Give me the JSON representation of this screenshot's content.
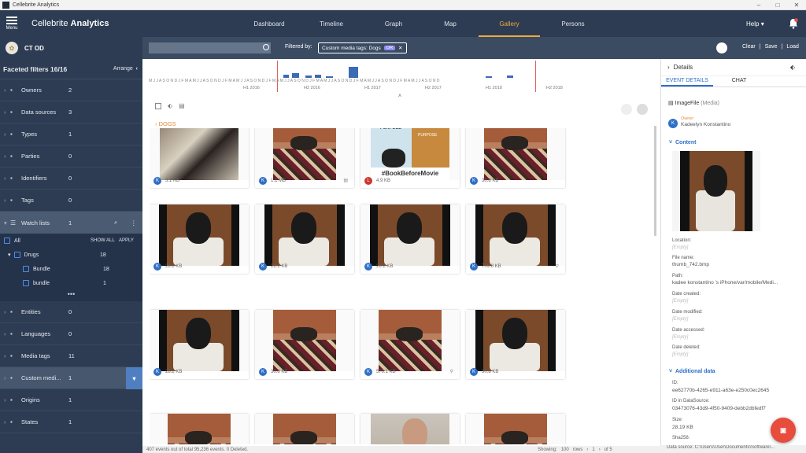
{
  "window": {
    "title": "Cellebrite Analytics"
  },
  "nav": {
    "menu_label": "Menu",
    "brand_a": "Cellebrite",
    "brand_b": "Analytics",
    "tabs": [
      {
        "label": "Dashboard"
      },
      {
        "label": "Timeline"
      },
      {
        "label": "Graph"
      },
      {
        "label": "Map"
      },
      {
        "label": "Gallery",
        "active": true
      },
      {
        "label": "Persons"
      }
    ],
    "help": "Help"
  },
  "case": {
    "name": "CT OD"
  },
  "search": {
    "placeholder": "Search..."
  },
  "filter": {
    "label": "Filtered by:",
    "chip": "Custom media tags: Dogs",
    "chip_badge": "OR"
  },
  "actions": {
    "clear": "Clear",
    "save": "Save",
    "load": "Load"
  },
  "sidebar": {
    "title": "Faceted filters 16/16",
    "arrange": "Arrange",
    "filters": [
      {
        "name": "Owners",
        "count": "2",
        "icon": "person-icon"
      },
      {
        "name": "Data sources",
        "count": "3",
        "icon": "phone-icon"
      },
      {
        "name": "Types",
        "count": "1",
        "icon": "grid-icon"
      },
      {
        "name": "Parties",
        "count": "0",
        "icon": "contact-icon"
      },
      {
        "name": "Identifiers",
        "count": "0",
        "icon": "id-card-icon"
      },
      {
        "name": "Tags",
        "count": "0",
        "icon": "tag-icon"
      }
    ],
    "watch": {
      "name": "Watch lists",
      "count": "1",
      "all": "All",
      "show_all": "SHOW ALL",
      "apply": "APPLY",
      "group": "Drugs",
      "group_count": "18",
      "items": [
        {
          "name": "Bundle",
          "count": "18"
        },
        {
          "name": "bundle",
          "count": "1"
        }
      ]
    },
    "more": "•••",
    "filters2": [
      {
        "name": "Entities",
        "count": "0",
        "icon": "globe-icon"
      },
      {
        "name": "Languages",
        "count": "0",
        "icon": "language-icon"
      },
      {
        "name": "Media tags",
        "count": "11",
        "icon": "image-icon"
      },
      {
        "name": "Custom medi...",
        "count": "1",
        "icon": "image-icon"
      },
      {
        "name": "Origins",
        "count": "1",
        "icon": "list-icon"
      },
      {
        "name": "States",
        "count": "1",
        "icon": "state-icon"
      }
    ]
  },
  "timeline": {
    "months": "M J J A S O N D J F M A M J J A S O N D J F M A M J J A S O N D J F M A M J J A S O N D J F M A M J J A S O N D J F M A M J J A S O N D J F M A M J J A S O N D",
    "years": [
      {
        "t": "H1 2016"
      },
      {
        "t": "H2 2016"
      },
      {
        "t": "H1 2017"
      },
      {
        "t": "H2 2017"
      },
      {
        "t": "H1 2018"
      },
      {
        "t": "H2 2018"
      }
    ]
  },
  "gallery": {
    "section": "DOGS",
    "cards": [
      {
        "size": "3.1 KB",
        "owner": "K",
        "scene": "blur"
      },
      {
        "size": "1.1 MB",
        "owner": "K",
        "scene": "bed",
        "icon": "doc-icon"
      },
      {
        "size": "4.9 KB",
        "owner": "L",
        "scene": "poster",
        "poster_t1": "DOG'S",
        "poster_t2": "PURPOSE",
        "poster_t3": "#BookBeforeMovie"
      },
      {
        "size": "30.8 KB",
        "owner": "K",
        "scene": "bed"
      },
      {
        "size": "28.2 KB",
        "owner": "K",
        "scene": "dog"
      },
      {
        "size": "28.2 KB",
        "owner": "K",
        "scene": "dog"
      },
      {
        "size": "28.2 KB",
        "owner": "K",
        "scene": "dog"
      },
      {
        "size": "709.8 KB",
        "owner": "K",
        "scene": "dog",
        "icon": "pin-icon"
      },
      {
        "size": "28.2 KB",
        "owner": "K",
        "scene": "dog"
      },
      {
        "size": "30.8 KB",
        "owner": "K",
        "scene": "bed"
      },
      {
        "size": "570.1 KB",
        "owner": "K",
        "scene": "bed",
        "icon": "pin-icon"
      },
      {
        "size": "30.8 KB",
        "owner": "K",
        "scene": "dog"
      },
      {
        "size": "",
        "owner": "",
        "scene": "bed"
      },
      {
        "size": "",
        "owner": "",
        "scene": "bed"
      },
      {
        "size": "",
        "owner": "",
        "scene": "face"
      },
      {
        "size": "",
        "owner": "",
        "scene": "bed"
      }
    ]
  },
  "status": {
    "events": "407 events out of total 95,236 events. 0 Deleted.",
    "showing": "Showing:",
    "per": "100",
    "rows": "rows",
    "page": "1",
    "of": "of 5"
  },
  "details": {
    "title": "Details",
    "tab1": "EVENT DETAILS",
    "tab2": "CHAT",
    "type": "ImageFile",
    "type_sub": "(Media)",
    "owner_label": "Owner",
    "owner": "Kadeelyn Konstantino",
    "content": "Content",
    "location_l": "Location:",
    "empty": "[Empty]",
    "filename_l": "File name:",
    "filename": "thumb_742.bmp",
    "path_l": "Path:",
    "path": "kadee konstantino 's iPhone/var/mobile/Medi...",
    "created_l": "Date created:",
    "modified_l": "Date modified:",
    "accessed_l": "Date accessed:",
    "deleted_l": "Date deleted:",
    "additional": "Additional data",
    "id_l": "ID:",
    "id": "ee62770b-4265-e911-a63e-e250c0ec2645",
    "dsid_l": "ID in DataSource:",
    "dsid": "03473076-43d9-4f50-9409-debb2dbfedf7",
    "size_l": "Size:",
    "size": "28.19 KB",
    "sha_l": "Sha256:"
  },
  "datasource": "Data source: C:\\Users\\User\\Documents\\Software\\..."
}
